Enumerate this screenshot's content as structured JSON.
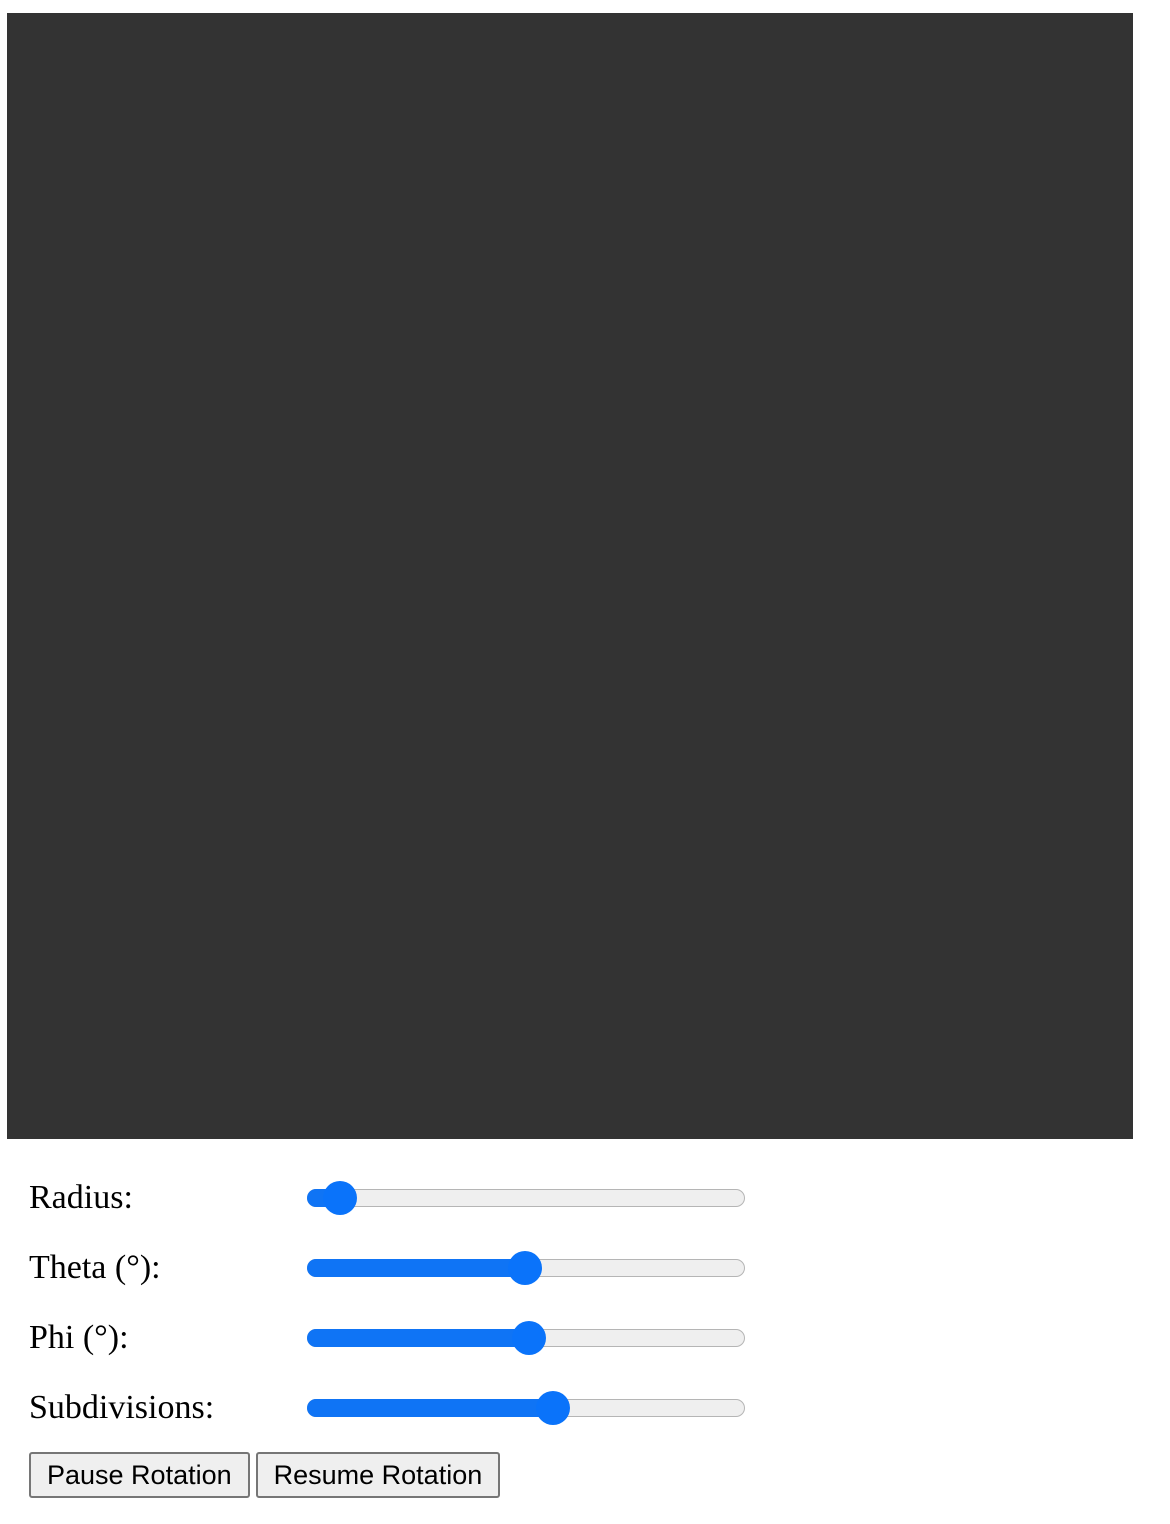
{
  "controls": {
    "radius": {
      "label": "Radius:",
      "level": 0.04
    },
    "theta": {
      "label": "Theta (°):",
      "level": 0.5
    },
    "phi": {
      "label": "Phi (°):",
      "level": 0.51
    },
    "subdivisions": {
      "label": "Subdivisions:",
      "level": 0.57
    }
  },
  "buttons": {
    "pause": "Pause Rotation",
    "resume": "Resume Rotation"
  },
  "colors": {
    "canvas_background": "#333333",
    "slider_accent": "#0f74f5"
  }
}
